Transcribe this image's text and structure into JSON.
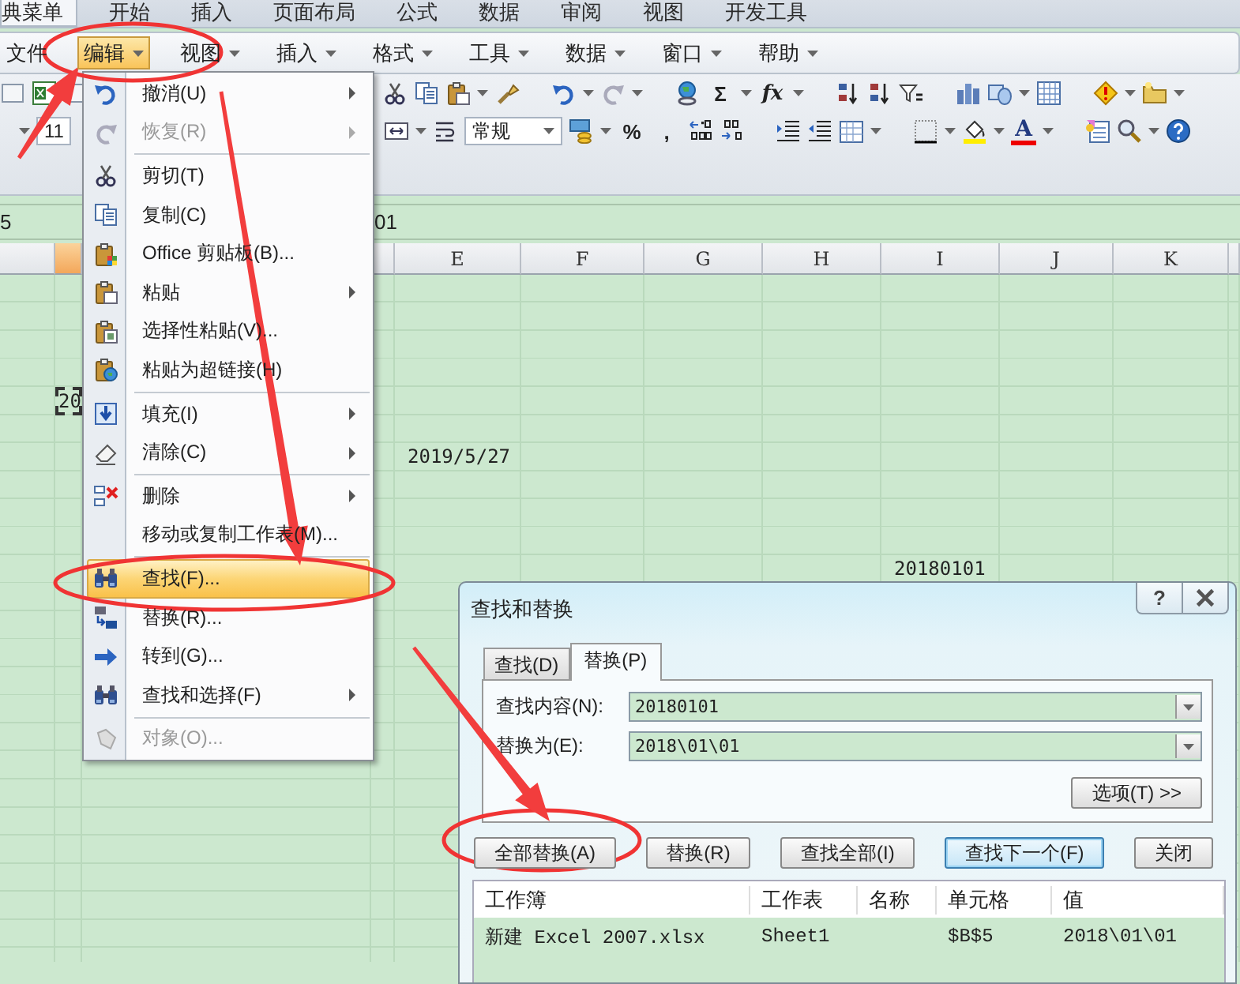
{
  "ribbon_tabs": [
    {
      "label": "典菜单",
      "selected": true
    },
    {
      "label": "开始",
      "selected": false
    },
    {
      "label": "插入",
      "selected": false
    },
    {
      "label": "页面布局",
      "selected": false
    },
    {
      "label": "公式",
      "selected": false
    },
    {
      "label": "数据",
      "selected": false
    },
    {
      "label": "审阅",
      "selected": false
    },
    {
      "label": "视图",
      "selected": false
    },
    {
      "label": "开发工具",
      "selected": false
    }
  ],
  "menu_bar": [
    {
      "label": "文件",
      "dropdown": false,
      "selected": false
    },
    {
      "label": "编辑",
      "dropdown": true,
      "selected": true
    },
    {
      "label": "视图",
      "dropdown": true,
      "selected": false
    },
    {
      "label": "插入",
      "dropdown": true,
      "selected": false
    },
    {
      "label": "格式",
      "dropdown": true,
      "selected": false
    },
    {
      "label": "工具",
      "dropdown": true,
      "selected": false
    },
    {
      "label": "数据",
      "dropdown": true,
      "selected": false
    },
    {
      "label": "窗口",
      "dropdown": true,
      "selected": false
    },
    {
      "label": "帮助",
      "dropdown": true,
      "selected": false
    }
  ],
  "toolbar": {
    "sum_button": "Σ",
    "function_button": "fx",
    "font_size": "11",
    "number_format": "常规",
    "percent_button": "%",
    "comma_button": ",",
    "font_color_button": "A"
  },
  "formula_bar": {
    "name_box": "5",
    "formula": "01"
  },
  "sheet": {
    "columns": [
      {
        "selected": true
      },
      {
        "label": "E",
        "selected": false
      },
      {
        "label": "F",
        "selected": false
      },
      {
        "label": "G",
        "selected": false
      },
      {
        "label": "H",
        "selected": false
      },
      {
        "label": "I",
        "selected": false
      },
      {
        "label": "J",
        "selected": false
      },
      {
        "label": "K",
        "selected": false
      }
    ],
    "cells": [
      {
        "text": "20",
        "marquee": true
      },
      {
        "text": "2019/5/27",
        "marquee": false
      },
      {
        "text": "20180101",
        "marquee": false
      }
    ]
  },
  "edit_menu": [
    {
      "kind": "item",
      "label": "撤消(U)",
      "disabled": false,
      "submenu": true,
      "selected": false
    },
    {
      "kind": "item",
      "label": "恢复(R)",
      "disabled": true,
      "submenu": true,
      "selected": false
    },
    {
      "kind": "separator"
    },
    {
      "kind": "item",
      "label": "剪切(T)",
      "disabled": false,
      "submenu": false,
      "selected": false
    },
    {
      "kind": "item",
      "label": "复制(C)",
      "disabled": false,
      "submenu": false,
      "selected": false
    },
    {
      "kind": "item",
      "label": "Office 剪贴板(B)...",
      "disabled": false,
      "submenu": false,
      "selected": false
    },
    {
      "kind": "item",
      "label": "粘贴",
      "disabled": false,
      "submenu": true,
      "selected": false
    },
    {
      "kind": "item",
      "label": "选择性粘贴(V)...",
      "disabled": false,
      "submenu": false,
      "selected": false
    },
    {
      "kind": "item",
      "label": "粘贴为超链接(H)",
      "disabled": false,
      "submenu": false,
      "selected": false
    },
    {
      "kind": "separator"
    },
    {
      "kind": "item",
      "label": "填充(I)",
      "disabled": false,
      "submenu": true,
      "selected": false
    },
    {
      "kind": "item",
      "label": "清除(C)",
      "disabled": false,
      "submenu": true,
      "selected": false
    },
    {
      "kind": "separator"
    },
    {
      "kind": "item",
      "label": "删除",
      "disabled": false,
      "submenu": true,
      "selected": false
    },
    {
      "kind": "item",
      "label": "移动或复制工作表(M)...",
      "disabled": false,
      "submenu": false,
      "selected": false
    },
    {
      "kind": "separator"
    },
    {
      "kind": "item",
      "label": "查找(F)...",
      "disabled": false,
      "submenu": false,
      "selected": true
    },
    {
      "kind": "item",
      "label": "替换(R)...",
      "disabled": false,
      "submenu": false,
      "selected": false
    },
    {
      "kind": "item",
      "label": "转到(G)...",
      "disabled": false,
      "submenu": false,
      "selected": false
    },
    {
      "kind": "item",
      "label": "查找和选择(F)",
      "disabled": false,
      "submenu": true,
      "selected": false
    },
    {
      "kind": "separator"
    },
    {
      "kind": "item",
      "label": "对象(O)...",
      "disabled": true,
      "submenu": false,
      "selected": false
    }
  ],
  "dialog": {
    "title": "查找和替换",
    "help_button": "?",
    "tabs": [
      {
        "label": "查找(D)",
        "selected": false
      },
      {
        "label": "替换(P)",
        "selected": true
      }
    ],
    "fields": [
      {
        "label": "查找内容(N):",
        "value": "20180101"
      },
      {
        "label": "替换为(E):",
        "value": "2018\\01\\01"
      }
    ],
    "options_button": "选项(T) >>",
    "buttons": [
      {
        "label": "全部替换(A)",
        "default": false
      },
      {
        "label": "替换(R)",
        "default": false
      },
      {
        "label": "查找全部(I)",
        "default": false
      },
      {
        "label": "查找下一个(F)",
        "default": true
      },
      {
        "label": "关闭",
        "default": false
      }
    ],
    "results": {
      "columns": [
        "工作簿",
        "工作表",
        "名称",
        "单元格",
        "值"
      ],
      "rows": [
        {
          "workbook": "新建 Excel 2007.xlsx",
          "sheet": "Sheet1",
          "cell": "$B$5",
          "value": "2018\\01\\01"
        }
      ]
    }
  }
}
